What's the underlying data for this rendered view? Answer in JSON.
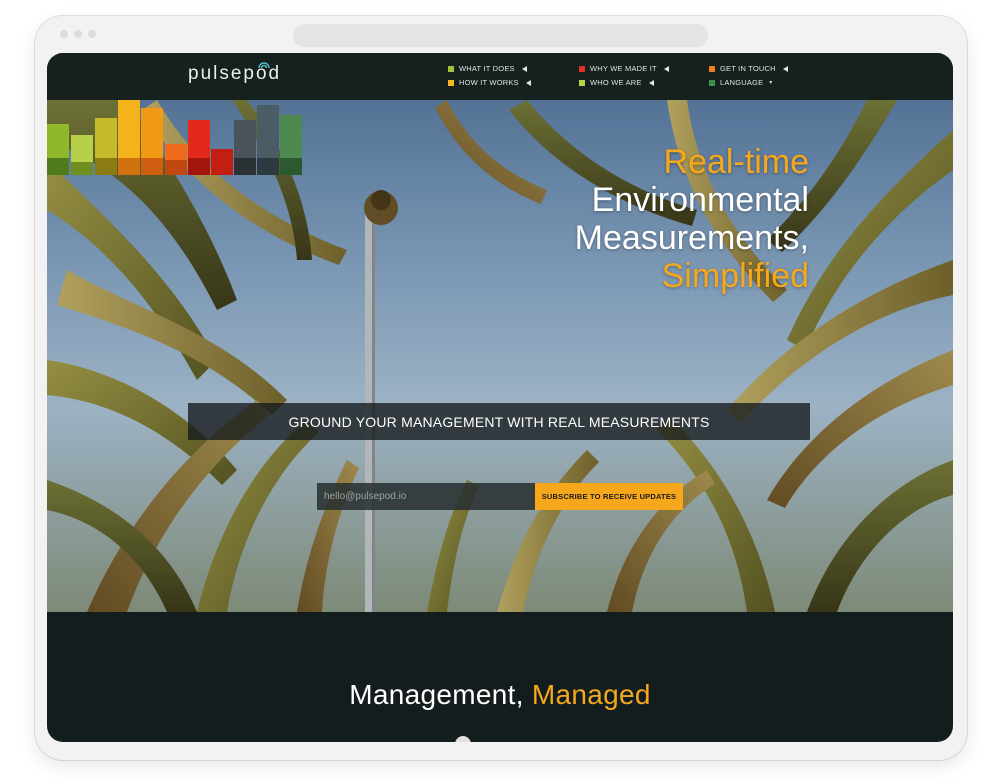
{
  "brand": {
    "name": "pulsepod"
  },
  "nav": {
    "items": [
      {
        "label": "WHAT IT DOES",
        "color": "#9fc33a",
        "marker": "arrow"
      },
      {
        "label": "WHY WE MADE IT",
        "color": "#e0301e",
        "marker": "arrow"
      },
      {
        "label": "GET IN TOUCH",
        "color": "#f07a1c",
        "marker": "arrow"
      },
      {
        "label": "HOW IT WORKS",
        "color": "#f3b81e",
        "marker": "arrow"
      },
      {
        "label": "WHO WE ARE",
        "color": "#b9d24a",
        "marker": "arrow"
      },
      {
        "label": "LANGUAGE",
        "color": "#3f8f4a",
        "marker": "caret"
      }
    ]
  },
  "hero": {
    "headline": {
      "line1": "Real-time",
      "line2": "Environmental",
      "line3": "Measurements,",
      "line4": "Simplified"
    },
    "tagline": "GROUND YOUR MANAGEMENT WITH REAL MEASUREMENTS",
    "subscribe": {
      "placeholder": "hello@pulsepod.io",
      "button_label": "SUBSCRIBE TO RECEIVE UPDATES"
    }
  },
  "section": {
    "title_part1": "Management,",
    "title_part2": "Managed"
  },
  "colors": {
    "accent": "#f5a81c",
    "dark_bg": "#141d1e",
    "button": "#f7a71b"
  }
}
